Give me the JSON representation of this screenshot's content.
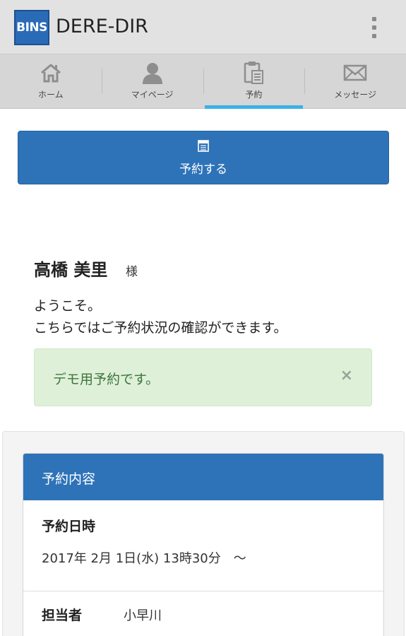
{
  "app": {
    "logo_text": "BINS",
    "title": "DERE-DIR",
    "accent_color": "#2e73b8",
    "tab_indicator_color": "#3cb0e6"
  },
  "tabs": [
    {
      "label": "ホーム",
      "icon": "home-icon",
      "active": false
    },
    {
      "label": "マイページ",
      "icon": "person-icon",
      "active": false
    },
    {
      "label": "予約",
      "icon": "clipboard-icon",
      "active": true
    },
    {
      "label": "メッセージ",
      "icon": "envelope-icon",
      "active": false
    }
  ],
  "reserve_button": {
    "label": "予約する",
    "icon": "calendar-icon"
  },
  "greeting": {
    "name": "高橋 美里",
    "honorific": "様",
    "line1": "ようこそ。",
    "line2": "こちらではご予約状況の確認ができます。"
  },
  "alert": {
    "text": "デモ用予約です。",
    "close": "×",
    "color": "#dff0d8"
  },
  "reservation": {
    "header": "予約内容",
    "datetime_label": "予約日時",
    "datetime_value": "2017年 2月 1日(水) 13時30分　～",
    "staff_label": "担当者",
    "staff_value": "小早川"
  }
}
